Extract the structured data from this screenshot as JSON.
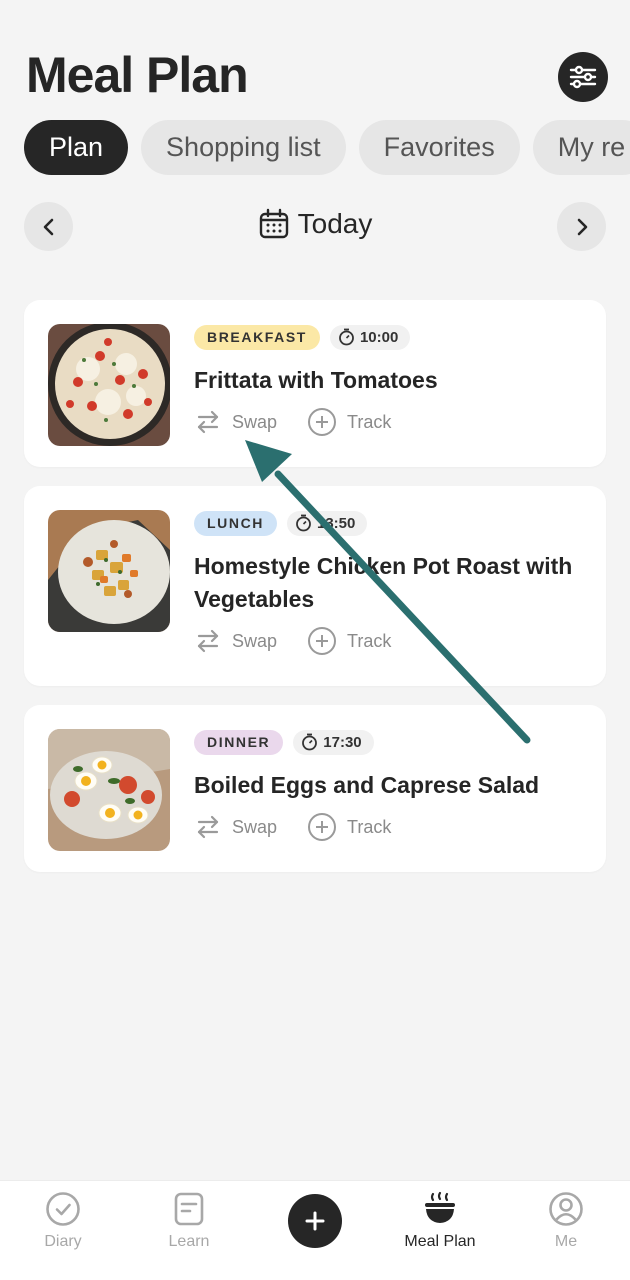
{
  "header": {
    "title": "Meal Plan",
    "settings_icon": "sliders-icon"
  },
  "tabs": [
    {
      "label": "Plan",
      "active": true
    },
    {
      "label": "Shopping list",
      "active": false
    },
    {
      "label": "Favorites",
      "active": false
    },
    {
      "label": "My re",
      "active": false
    }
  ],
  "date_nav": {
    "label": "Today",
    "icon": "calendar-icon",
    "prev_icon": "chevron-left-icon",
    "next_icon": "chevron-right-icon"
  },
  "meals": [
    {
      "type": "BREAKFAST",
      "time": "10:00",
      "name": "Frittata with Tomatoes",
      "swap_label": "Swap",
      "track_label": "Track"
    },
    {
      "type": "LUNCH",
      "time": "13:50",
      "name": "Homestyle Chicken Pot Roast with Vegetables",
      "swap_label": "Swap",
      "track_label": "Track"
    },
    {
      "type": "DINNER",
      "time": "17:30",
      "name": "Boiled Eggs and Caprese Salad",
      "swap_label": "Swap",
      "track_label": "Track"
    }
  ],
  "bottom_nav": [
    {
      "label": "Diary",
      "icon": "check-circle-icon"
    },
    {
      "label": "Learn",
      "icon": "book-icon"
    },
    {
      "label": "",
      "icon": "plus-icon"
    },
    {
      "label": "Meal Plan",
      "icon": "bowl-icon",
      "active": true
    },
    {
      "label": "Me",
      "icon": "user-icon"
    }
  ],
  "colors": {
    "background": "#f4f4f4",
    "dark": "#262626",
    "breakfast_tag": "#fbe8a6",
    "lunch_tag": "#cfe3f7",
    "dinner_tag": "#ead8ec",
    "annotation_arrow": "#2b6f6f"
  }
}
